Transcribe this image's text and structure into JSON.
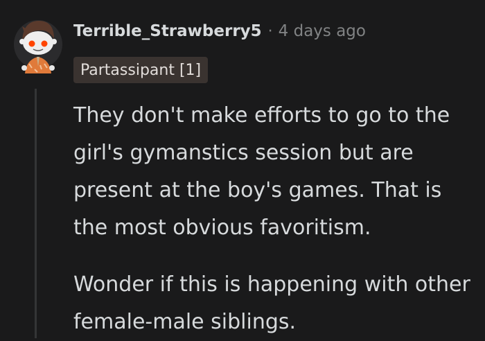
{
  "comment": {
    "author": "Terrible_Strawberry5",
    "separator": "·",
    "timestamp": "4 days ago",
    "flair": "Partassipant [1]",
    "avatar_icon": "snoo-avatar-icon",
    "paragraphs": [
      "They don't make efforts to go to the girl's gymanstics session but are present at the boy's games. That is the most obvious favoritism.",
      "Wonder if this is happening with other female-male siblings."
    ]
  },
  "colors": {
    "background": "#1a1a1b",
    "text": "#d7dadc",
    "meta": "#818384",
    "flair_bg": "#3a3330",
    "thread_line": "#343536"
  }
}
